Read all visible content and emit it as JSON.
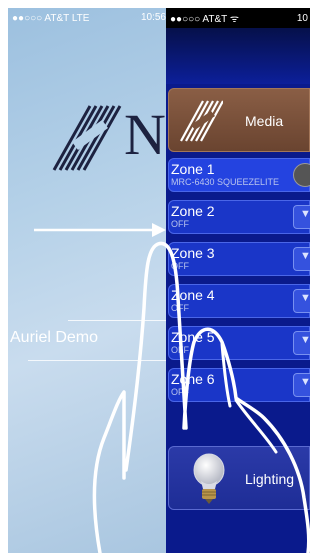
{
  "left_app": {
    "status_bar": {
      "carrier": "●●○○○ AT&T  LTE",
      "time": "10:56"
    },
    "site_name": "Auriel Demo"
  },
  "right_app": {
    "status_bar": {
      "carrier": "●●○○○ AT&T ᯤ",
      "time": "10"
    },
    "media": {
      "label": "Media",
      "icon": "media-logo-icon"
    },
    "zones": [
      {
        "name": "Zone 1",
        "status": "MRC-6430 SQUEEZELITE",
        "button_icon": "source-icon"
      },
      {
        "name": "Zone 2",
        "status": "OFF",
        "button_icon": "chevron-down-icon"
      },
      {
        "name": "Zone 3",
        "status": "OFF",
        "button_icon": "chevron-down-icon"
      },
      {
        "name": "Zone 4",
        "status": "OFF",
        "button_icon": "chevron-down-icon"
      },
      {
        "name": "Zone 5",
        "status": "OFF",
        "button_icon": "chevron-down-icon"
      },
      {
        "name": "Zone 6",
        "status": "OFF",
        "button_icon": "chevron-down-icon"
      }
    ],
    "lighting": {
      "label": "Lighting",
      "icon": "lightbulb-icon"
    }
  },
  "colors": {
    "panel_blue": "#0a1a8c",
    "zone_blue": "#1a36c8",
    "media_brown": "#7a523b"
  }
}
